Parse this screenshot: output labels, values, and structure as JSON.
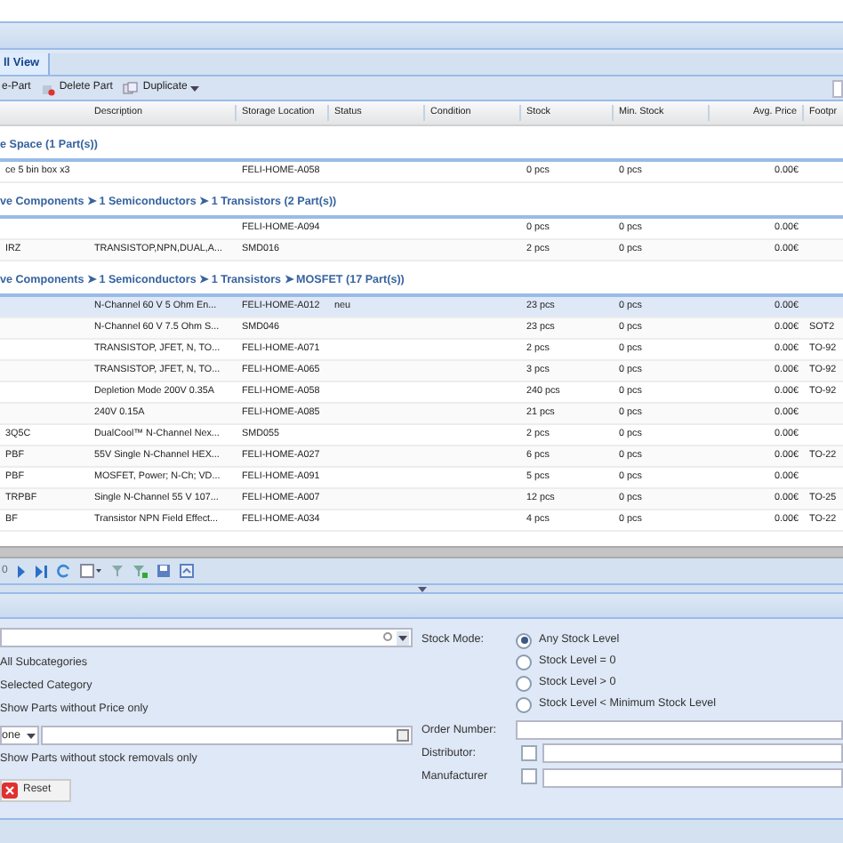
{
  "tabs": [
    {
      "label": "ll View",
      "selected": true
    }
  ],
  "toolbar": [
    "e-Part",
    "Delete Part",
    "Duplicate"
  ],
  "columns": [
    "",
    "Description",
    "Storage Location",
    "Status",
    "Condition",
    "Stock",
    "Min. Stock",
    "Avg. Price",
    "Footpr"
  ],
  "groups": [
    {
      "title": "e Space (1 Part(s))",
      "rows": [
        {
          "cells": [
            "ce 5 bin box x3",
            "",
            "FELI-HOME-A058",
            "",
            "",
            "0 pcs",
            "0 pcs",
            "0.00€",
            ""
          ],
          "selected": false
        }
      ]
    },
    {
      "title": "ve Components ➤ 1 Semiconductors ➤ 1 Transistors (2 Part(s))",
      "rows": [
        {
          "cells": [
            "",
            "",
            "FELI-HOME-A094",
            "",
            "",
            "0 pcs",
            "0 pcs",
            "0.00€",
            ""
          ],
          "selected": false
        },
        {
          "cells": [
            "IRZ",
            "TRANSISTOP,NPN,DUAL,A...",
            "SMD016",
            "",
            "",
            "2 pcs",
            "0 pcs",
            "0.00€",
            ""
          ],
          "selected": false
        }
      ]
    },
    {
      "title": "ve Components ➤ 1 Semiconductors ➤ 1 Transistors ➤ MOSFET (17 Part(s))",
      "rows": [
        {
          "cells": [
            "",
            "N-Channel 60 V 5 Ohm En...",
            "FELI-HOME-A012",
            "neu",
            "",
            "23 pcs",
            "0 pcs",
            "0.00€",
            ""
          ],
          "selected": true
        },
        {
          "cells": [
            "",
            "N-Channel 60 V 7.5 Ohm S...",
            "SMD046",
            "",
            "",
            "23 pcs",
            "0 pcs",
            "0.00€",
            "SOT2"
          ],
          "selected": false
        },
        {
          "cells": [
            "",
            "TRANSISTOP, JFET, N, TO...",
            "FELI-HOME-A071",
            "",
            "",
            "2 pcs",
            "0 pcs",
            "0.00€",
            "TO-92"
          ],
          "selected": false
        },
        {
          "cells": [
            "",
            "TRANSISTOP, JFET, N, TO...",
            "FELI-HOME-A065",
            "",
            "",
            "3 pcs",
            "0 pcs",
            "0.00€",
            "TO-92"
          ],
          "selected": false
        },
        {
          "cells": [
            "",
            "Depletion Mode 200V 0.35A",
            "FELI-HOME-A058",
            "",
            "",
            "240 pcs",
            "0 pcs",
            "0.00€",
            "TO-92"
          ],
          "selected": false
        },
        {
          "cells": [
            "",
            "240V 0.15A",
            "FELI-HOME-A085",
            "",
            "",
            "21 pcs",
            "0 pcs",
            "0.00€",
            ""
          ],
          "selected": false
        },
        {
          "cells": [
            "3Q5C",
            "DualCool™ N-Channel Nex...",
            "SMD055",
            "",
            "",
            "2 pcs",
            "0 pcs",
            "0.00€",
            ""
          ],
          "selected": false
        },
        {
          "cells": [
            "PBF",
            "55V Single N-Channel HEX...",
            "FELI-HOME-A027",
            "",
            "",
            "6 pcs",
            "0 pcs",
            "0.00€",
            "TO-22"
          ],
          "selected": false
        },
        {
          "cells": [
            "PBF",
            "MOSFET, Power; N-Ch; VD...",
            "FELI-HOME-A091",
            "",
            "",
            "5 pcs",
            "0 pcs",
            "0.00€",
            ""
          ],
          "selected": false
        },
        {
          "cells": [
            "TRPBF",
            "Single N-Channel 55 V 107...",
            "FELI-HOME-A007",
            "",
            "",
            "12 pcs",
            "0 pcs",
            "0.00€",
            "TO-25"
          ],
          "selected": false
        },
        {
          "cells": [
            "BF",
            "Transistor NPN Field Effect...",
            "FELI-HOME-A034",
            "",
            "",
            "4 pcs",
            "0 pcs",
            "0.00€",
            "TO-22"
          ],
          "selected": false
        }
      ]
    }
  ],
  "pager": {
    "page": "0"
  },
  "filter": {
    "left": [
      {
        "kind": "combo"
      },
      {
        "kind": "text",
        "label": "All Subcategories"
      },
      {
        "kind": "text",
        "label": "Selected Category"
      },
      {
        "kind": "text",
        "label": "Show Parts without Price only"
      },
      {
        "kind": "combo-date",
        "value": "one"
      },
      {
        "kind": "text",
        "label": "Show Parts without stock removals only"
      }
    ],
    "reset": "Reset",
    "stock_mode_label": "Stock Mode:",
    "stock_modes": [
      {
        "label": "Any Stock Level",
        "selected": true
      },
      {
        "label": "Stock Level = 0",
        "selected": false
      },
      {
        "label": "Stock Level > 0",
        "selected": false
      },
      {
        "label": "Stock Level < Minimum Stock Level",
        "selected": false
      }
    ],
    "order_number_label": "Order Number:",
    "distributor": {
      "label": "Distributor:",
      "checked": false
    },
    "manufacturer": {
      "label": "Manufacturer",
      "checked": false
    }
  }
}
